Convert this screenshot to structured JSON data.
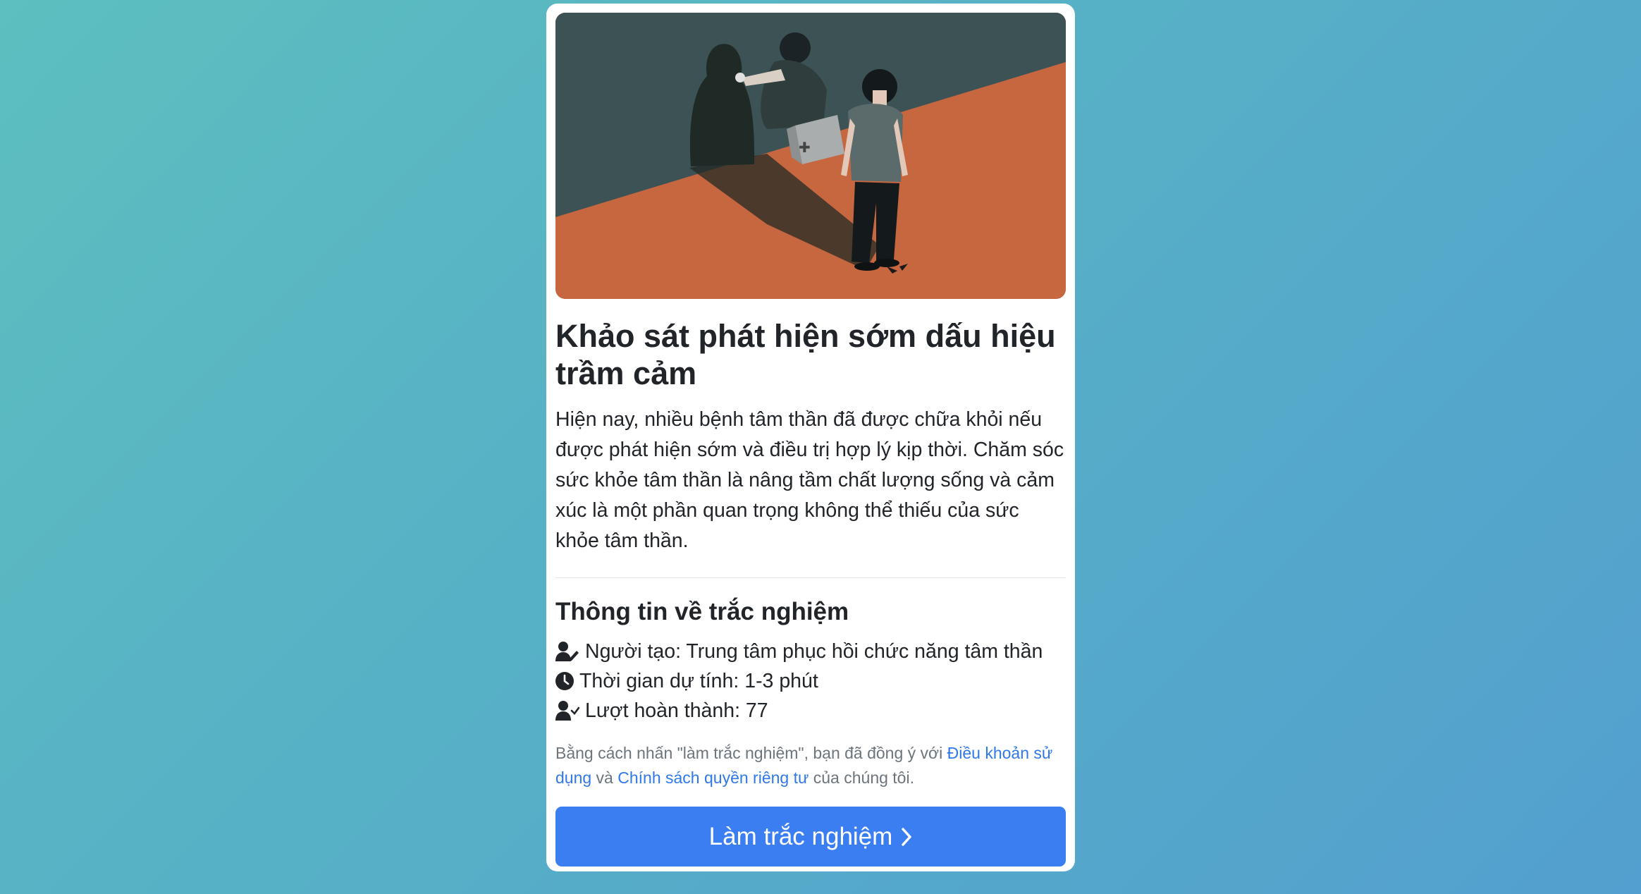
{
  "hero": {
    "image": "illustration-doctor-checking-shadow-figure",
    "colors": {
      "wall": "#3d5254",
      "floor": "#c6673f"
    }
  },
  "title": "Khảo sát phát hiện sớm dấu hiệu trầm cảm",
  "description": "Hiện nay, nhiều bệnh tâm thần đã được chữa khỏi nếu được phát hiện sớm và điều trị hợp lý kịp thời. Chăm sóc sức khỏe tâm thần là nâng tầm chất lượng sống và cảm xúc là một phần quan trọng không thể thiếu của sức khỏe tâm thần.",
  "info": {
    "heading": "Thông tin về trắc nghiệm",
    "creator": {
      "icon": "user-pen-icon",
      "text": "Người tạo: Trung tâm phục hồi chức năng tâm thần"
    },
    "duration": {
      "icon": "clock-icon",
      "text": "Thời gian dự tính: 1-3 phút"
    },
    "completions": {
      "icon": "user-check-icon",
      "text": "Lượt hoàn thành: 77"
    }
  },
  "consent": {
    "prefix": "Bằng cách nhấn \"làm trắc nghiệm\", bạn đã đồng ý với ",
    "terms_link": "Điều khoản sử dụng",
    "middle": " và ",
    "privacy_link": "Chính sách quyền riêng tư",
    "suffix": " của chúng tôi."
  },
  "button": {
    "label": "Làm trắc nghiệm",
    "icon": "chevron-right-icon",
    "color": "#3a7ef2"
  }
}
